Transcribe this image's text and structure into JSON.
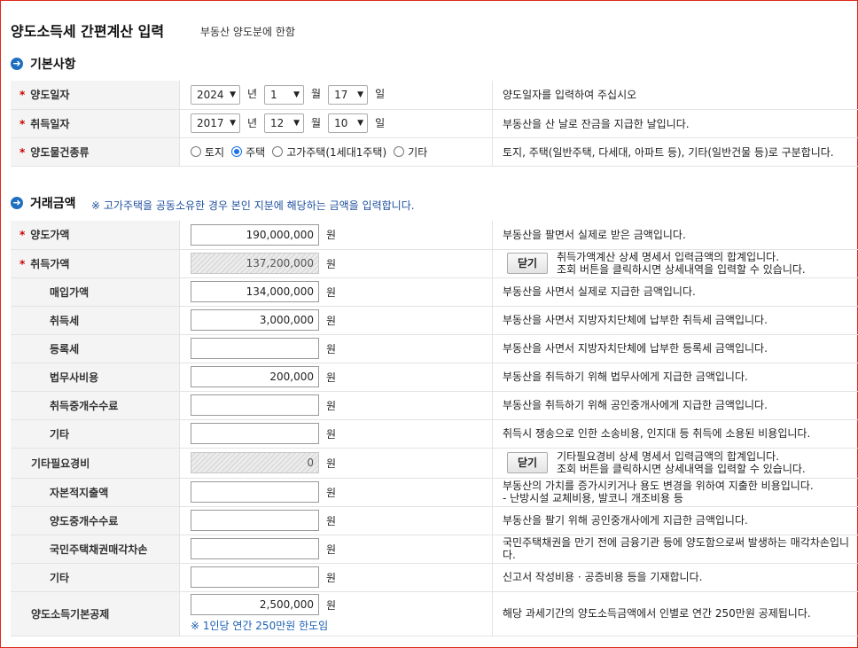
{
  "title": "양도소득세 간편계산 입력",
  "subtitle": "부동산 양도분에 한함",
  "basic": {
    "heading": "기본사항",
    "heading_icon": "arrow-right-circle-icon",
    "transfer_date": {
      "label": "양도일자",
      "year": "2024",
      "month": "1",
      "day": "17",
      "year_unit": "년",
      "month_unit": "월",
      "day_unit": "일",
      "desc": "양도일자를 입력하여 주십시오"
    },
    "acquire_date": {
      "label": "취득일자",
      "year": "2017",
      "month": "12",
      "day": "10",
      "year_unit": "년",
      "month_unit": "월",
      "day_unit": "일",
      "desc": "부동산을 산 날로 잔금을 지급한 날입니다."
    },
    "property_type": {
      "label": "양도물건종류",
      "options": [
        "토지",
        "주택",
        "고가주택(1세대1주택)",
        "기타"
      ],
      "selected": "주택",
      "desc": "토지, 주택(일반주택, 다세대, 아파트 등), 기타(일반건물 등)로 구분합니다."
    }
  },
  "amounts": {
    "heading": "거래금액",
    "heading_icon": "arrow-right-circle-icon",
    "note": "※ 고가주택을 공동소유한 경우 본인 지분에 해당하는 금액을 입력합니다.",
    "currency": "원",
    "rows": [
      {
        "label": "양도가액",
        "required": true,
        "indent": 0,
        "value": "190,000,000",
        "disabled": false,
        "button": "",
        "desc": [
          "부동산을 팔면서 실제로 받은 금액입니다."
        ]
      },
      {
        "label": "취득가액",
        "required": true,
        "indent": 0,
        "value": "137,200,000",
        "disabled": true,
        "button": "닫기",
        "desc": [
          "취득가액계산 상세 명세서 입력금액의 합계입니다.",
          "조회 버튼을 클릭하시면 상세내역을 입력할 수 있습니다."
        ]
      },
      {
        "label": "매입가액",
        "required": false,
        "indent": 2,
        "value": "134,000,000",
        "disabled": false,
        "button": "",
        "desc": [
          "부동산을 사면서 실제로 지급한 금액입니다."
        ]
      },
      {
        "label": "취득세",
        "required": false,
        "indent": 2,
        "value": "3,000,000",
        "disabled": false,
        "button": "",
        "desc": [
          "부동산을 사면서 지방자치단체에 납부한 취득세 금액입니다."
        ]
      },
      {
        "label": "등록세",
        "required": false,
        "indent": 2,
        "value": "",
        "disabled": false,
        "button": "",
        "desc": [
          "부동산을 사면서 지방자치단체에 납부한 등록세 금액입니다."
        ]
      },
      {
        "label": "법무사비용",
        "required": false,
        "indent": 2,
        "value": "200,000",
        "disabled": false,
        "button": "",
        "desc": [
          "부동산을 취득하기 위해 법무사에게 지급한 금액입니다."
        ]
      },
      {
        "label": "취득중개수수료",
        "required": false,
        "indent": 2,
        "value": "",
        "disabled": false,
        "button": "",
        "desc": [
          "부동산을 취득하기 위해 공인중개사에게 지급한 금액입니다."
        ]
      },
      {
        "label": "기타",
        "required": false,
        "indent": 2,
        "value": "",
        "disabled": false,
        "button": "",
        "desc": [
          "취득시 쟁송으로 인한 소송비용, 인지대 등 취득에 소용된 비용입니다."
        ]
      },
      {
        "label": "기타필요경비",
        "required": false,
        "indent": 1,
        "value": "0",
        "disabled": true,
        "button": "닫기",
        "desc": [
          "기타필요경비 상세 명세서 입력금액의 합계입니다.",
          "조회 버튼을 클릭하시면 상세내역을 입력할 수 있습니다."
        ]
      },
      {
        "label": "자본적지출액",
        "required": false,
        "indent": 2,
        "value": "",
        "disabled": false,
        "button": "",
        "desc": [
          "부동산의 가치를 증가시키거나 용도 변경을 위하여 지출한 비용입니다.",
          "- 난방시설 교체비용, 발코니 개조비용 등"
        ]
      },
      {
        "label": "양도중개수수료",
        "required": false,
        "indent": 2,
        "value": "",
        "disabled": false,
        "button": "",
        "desc": [
          "부동산을 팔기 위해 공인중개사에게 지급한 금액입니다."
        ]
      },
      {
        "label": "국민주택채권매각차손",
        "required": false,
        "indent": 2,
        "value": "",
        "disabled": false,
        "button": "",
        "desc": [
          "국민주택채권을 만기 전에 금융기관 등에 양도함으로써 발생하는 매각차손입니다."
        ]
      },
      {
        "label": "기타",
        "required": false,
        "indent": 2,
        "value": "",
        "disabled": false,
        "button": "",
        "desc": [
          "신고서 작성비용 · 공증비용 등을 기재합니다."
        ]
      },
      {
        "label": "양도소득기본공제",
        "required": false,
        "indent": 1,
        "value": "2,500,000",
        "disabled": false,
        "button": "",
        "hint": "※ 1인당 연간 250만원 한도임",
        "desc": [
          "해당 과세기간의 양도소득금액에서 인별로 연간 250만원 공제됩니다."
        ]
      }
    ]
  }
}
